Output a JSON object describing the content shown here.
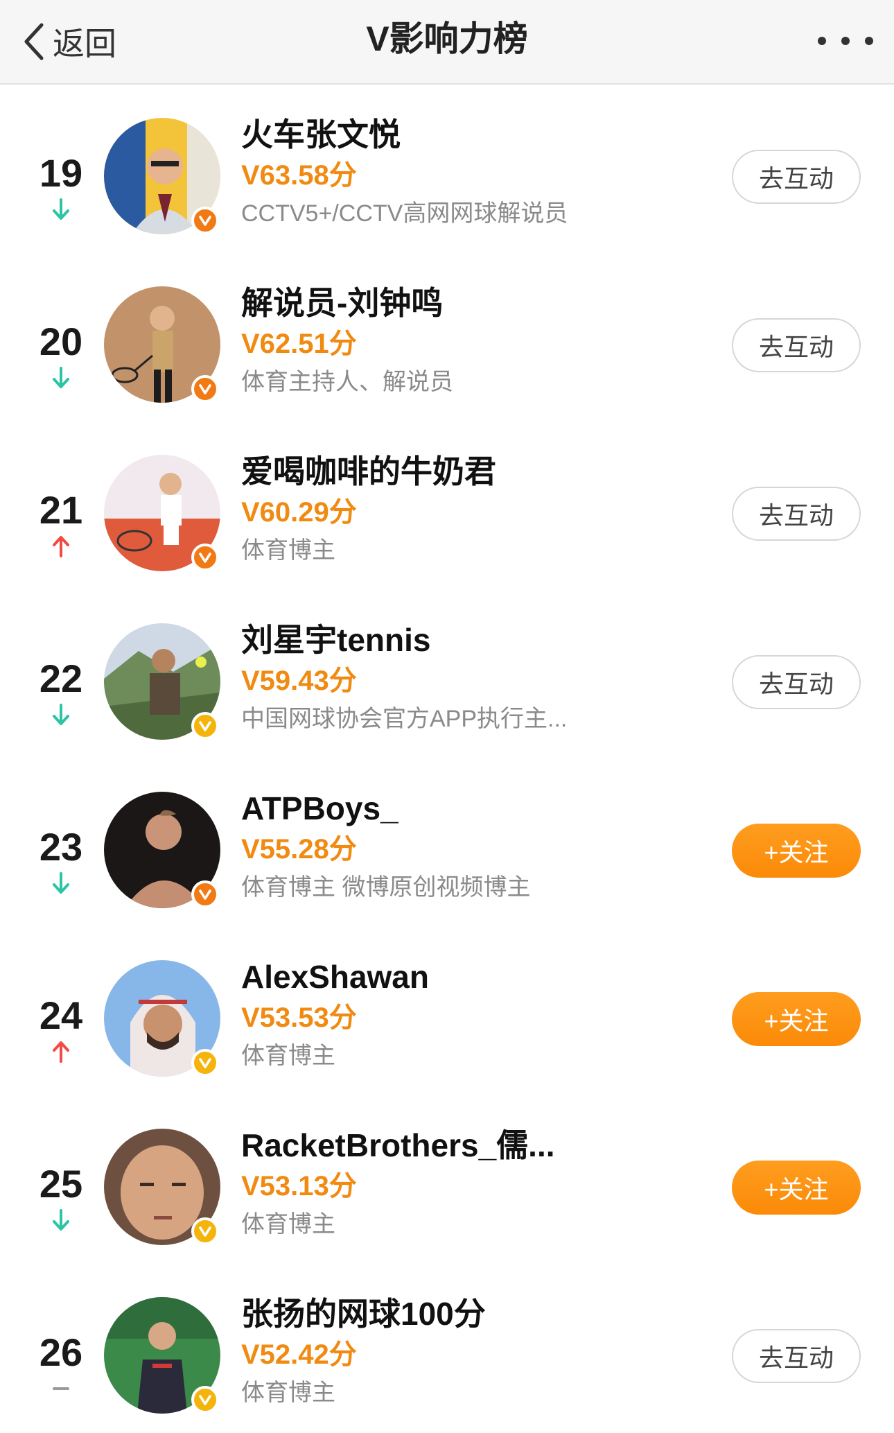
{
  "header": {
    "back_label": "返回",
    "title": "V影响力榜",
    "more_icon": "more-dots-icon",
    "back_icon": "chevron-left-icon"
  },
  "colors": {
    "score": "#f08a10",
    "trend_down": "#2cc4a6",
    "trend_up": "#f24a45",
    "trend_flat": "#9a9a9a",
    "follow_button": "#fb8a08",
    "badge_orange": "#f27a15",
    "badge_gold": "#f5b40c"
  },
  "items": [
    {
      "rank": "19",
      "trend": "down",
      "name": "火车张文悦",
      "score": "V63.58分",
      "desc": "CCTV5+/CCTV高网网球解说员",
      "button": "去互动",
      "button_type": "interact",
      "badge": "orange"
    },
    {
      "rank": "20",
      "trend": "down",
      "name": "解说员-刘钟鸣",
      "score": "V62.51分",
      "desc": "体育主持人、解说员",
      "button": "去互动",
      "button_type": "interact",
      "badge": "orange"
    },
    {
      "rank": "21",
      "trend": "up",
      "name": "爱喝咖啡的牛奶君",
      "score": "V60.29分",
      "desc": "体育博主",
      "button": "去互动",
      "button_type": "interact",
      "badge": "orange"
    },
    {
      "rank": "22",
      "trend": "down",
      "name": "刘星宇tennis",
      "score": "V59.43分",
      "desc": "中国网球协会官方APP执行主...",
      "button": "去互动",
      "button_type": "interact",
      "badge": "gold"
    },
    {
      "rank": "23",
      "trend": "down",
      "name": "ATPBoys_",
      "score": "V55.28分",
      "desc": "体育博主 微博原创视频博主",
      "button": "+关注",
      "button_type": "follow",
      "badge": "orange"
    },
    {
      "rank": "24",
      "trend": "up",
      "name": "AlexShawan",
      "score": "V53.53分",
      "desc": "体育博主",
      "button": "+关注",
      "button_type": "follow",
      "badge": "gold"
    },
    {
      "rank": "25",
      "trend": "down",
      "name": "RacketBrothers_儒...",
      "score": "V53.13分",
      "desc": "体育博主",
      "button": "+关注",
      "button_type": "follow",
      "badge": "gold"
    },
    {
      "rank": "26",
      "trend": "flat",
      "name": "张扬的网球100分",
      "score": "V52.42分",
      "desc": "体育博主",
      "button": "去互动",
      "button_type": "interact",
      "badge": "gold"
    }
  ]
}
